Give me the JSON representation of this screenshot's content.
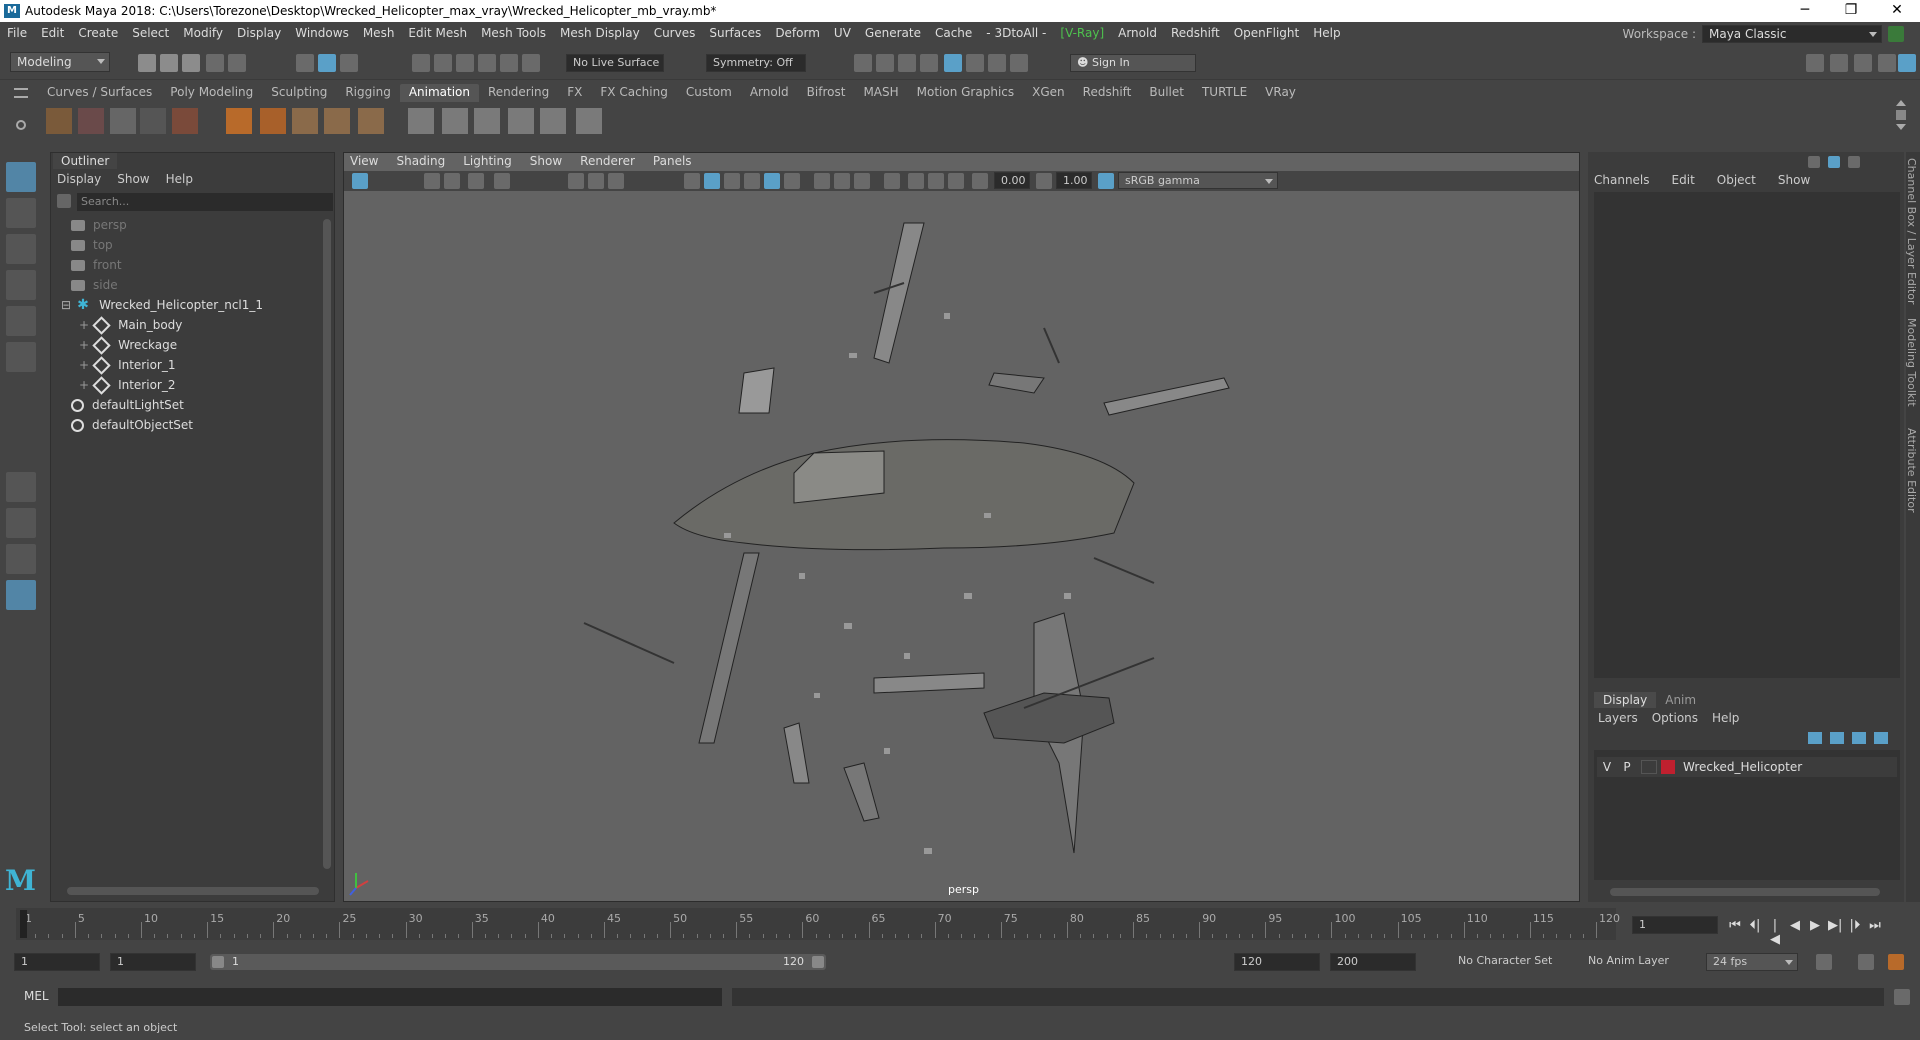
{
  "window": {
    "title": "Autodesk Maya 2018: C:\\Users\\Torezone\\Desktop\\Wrecked_Helicopter_max_vray\\Wrecked_Helicopter_mb_vray.mb*",
    "logo_letter": "M",
    "minimize": "─",
    "maximize": "❐",
    "close": "✕"
  },
  "menubar": {
    "items": [
      "File",
      "Edit",
      "Create",
      "Select",
      "Modify",
      "Display",
      "Windows",
      "Mesh",
      "Edit Mesh",
      "Mesh Tools",
      "Mesh Display",
      "Curves",
      "Surfaces",
      "Deform",
      "UV",
      "Generate",
      "Cache",
      "- 3DtoAll -",
      "[V-Ray]",
      "Arnold",
      "Redshift",
      "OpenFlight",
      "Help"
    ],
    "workspace_label": "Workspace :",
    "workspace_value": "Maya Classic"
  },
  "statusline": {
    "mode": "Modeling",
    "live_surface": "No Live Surface",
    "symmetry": "Symmetry: Off",
    "sign_in": "Sign In"
  },
  "shelf": {
    "tabs": [
      "Curves / Surfaces",
      "Poly Modeling",
      "Sculpting",
      "Rigging",
      "Animation",
      "Rendering",
      "FX",
      "FX Caching",
      "Custom",
      "Arnold",
      "Bifrost",
      "MASH",
      "Motion Graphics",
      "XGen",
      "Redshift",
      "Bullet",
      "TURTLE",
      "VRay"
    ],
    "active_tab": "Animation"
  },
  "outliner": {
    "title": "Outliner",
    "menu": [
      "Display",
      "Show",
      "Help"
    ],
    "search_placeholder": "Search...",
    "items": [
      {
        "label": "persp",
        "icon": "camera-icon",
        "dim": true,
        "indent": 1
      },
      {
        "label": "top",
        "icon": "camera-icon",
        "dim": true,
        "indent": 1
      },
      {
        "label": "front",
        "icon": "camera-icon",
        "dim": true,
        "indent": 1
      },
      {
        "label": "side",
        "icon": "camera-icon",
        "dim": true,
        "indent": 1
      },
      {
        "label": "Wrecked_Helicopter_ncl1_1",
        "icon": "group-icon",
        "dim": false,
        "indent": 0
      },
      {
        "label": "Main_body",
        "icon": "mesh-icon",
        "dim": false,
        "indent": 2
      },
      {
        "label": "Wreckage",
        "icon": "mesh-icon",
        "dim": false,
        "indent": 2
      },
      {
        "label": "Interior_1",
        "icon": "mesh-icon",
        "dim": false,
        "indent": 2
      },
      {
        "label": "Interior_2",
        "icon": "mesh-icon",
        "dim": false,
        "indent": 2
      },
      {
        "label": "defaultLightSet",
        "icon": "set-icon",
        "dim": false,
        "indent": 1
      },
      {
        "label": "defaultObjectSet",
        "icon": "set-icon",
        "dim": false,
        "indent": 1
      }
    ]
  },
  "viewport": {
    "menu": [
      "View",
      "Shading",
      "Lighting",
      "Show",
      "Renderer",
      "Panels"
    ],
    "exposure": "0.00",
    "gamma": "1.00",
    "color_space": "sRGB gamma",
    "camera_label": "persp"
  },
  "channelbox": {
    "menu": [
      "Channels",
      "Edit",
      "Object",
      "Show"
    ],
    "tabs": [
      "Display",
      "Anim"
    ],
    "active_tab": "Display",
    "layer_menu": [
      "Layers",
      "Options",
      "Help"
    ],
    "layer": {
      "v": "V",
      "p": "P",
      "name": "Wrecked_Helicopter",
      "color": "#c0202f"
    },
    "side_tabs": [
      "Channel Box / Layer Editor",
      "Modeling Toolkit",
      "Attribute Editor"
    ]
  },
  "timeline": {
    "ticks": [
      1,
      5,
      10,
      15,
      20,
      25,
      30,
      35,
      40,
      45,
      50,
      55,
      60,
      65,
      70,
      75,
      80,
      85,
      90,
      95,
      100,
      105,
      110,
      115,
      120
    ],
    "current_frame": "1",
    "playback_buttons": [
      "⏮",
      "⏴|",
      "|◀",
      "◀",
      "▶",
      "▶|",
      "|⏵",
      "⏭"
    ]
  },
  "range": {
    "start": "1",
    "playback_start": "1",
    "slider_start": "1",
    "slider_end": "120",
    "playback_end": "120",
    "end": "200",
    "character_set": "No Character Set",
    "anim_layer": "No Anim Layer",
    "fps": "24 fps"
  },
  "cmdline": {
    "label": "MEL"
  },
  "helpline": {
    "text": "Select Tool: select an object"
  }
}
